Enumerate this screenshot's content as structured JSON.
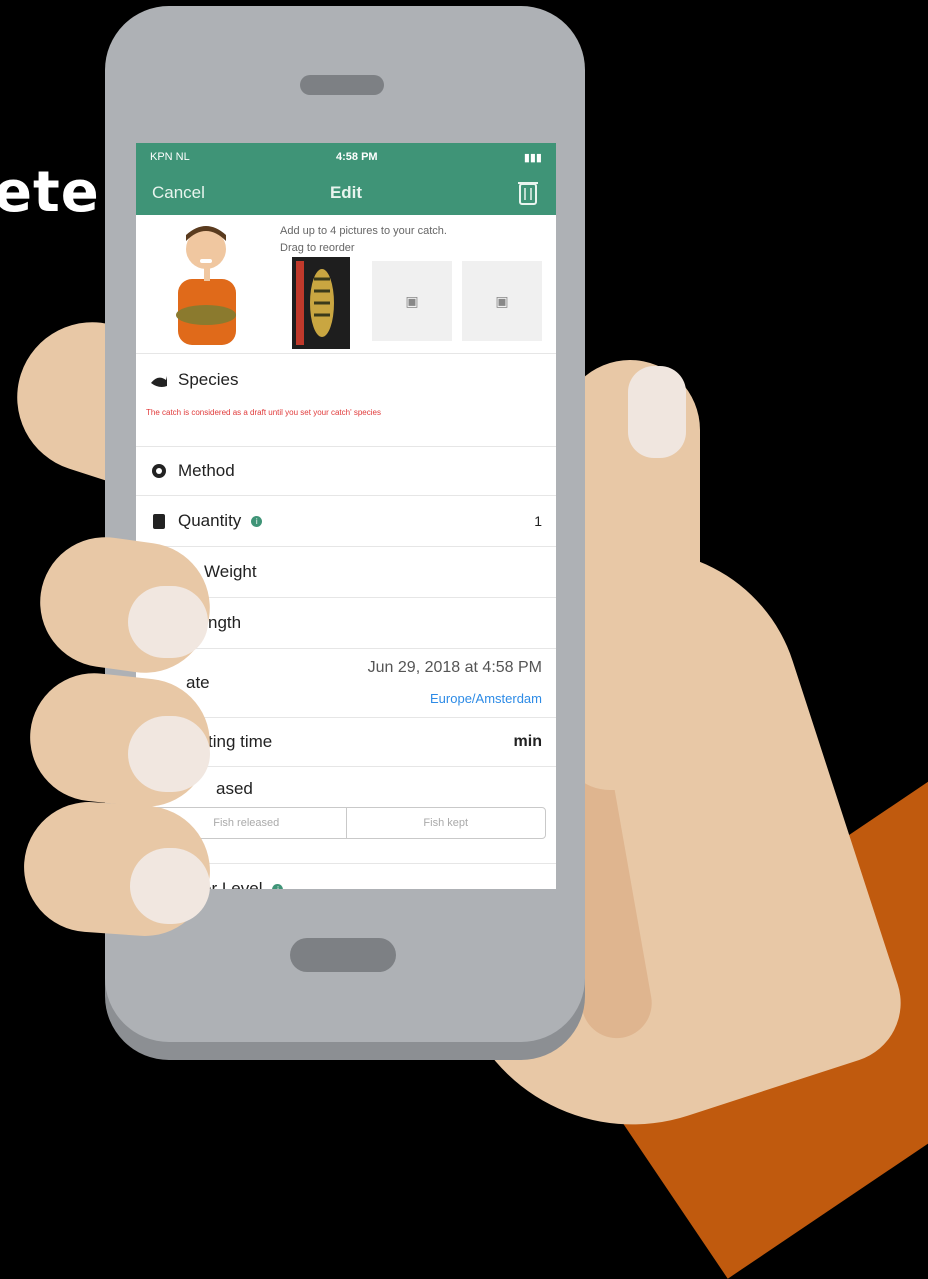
{
  "headline": "ete",
  "status_bar": {
    "carrier": "KPN NL",
    "time": "4:58 PM"
  },
  "nav": {
    "cancel_label": "Cancel",
    "title": "Edit"
  },
  "photos": {
    "hint_line1": "Add up to 4 pictures to your catch.",
    "hint_line2": "Drag to reorder"
  },
  "fields": {
    "species_label": "Species",
    "species_note": "The catch is considered as a draft until you set your catch' species",
    "method_label": "Method",
    "quantity_label": "Quantity",
    "quantity_value": "1",
    "weight_label": "Weight",
    "length_label": "ngth",
    "date_label": "ate",
    "date_value": "Jun 29, 2018 at 4:58 PM",
    "timezone_value": "Europe/Amsterdam",
    "fighting_label": "ting time",
    "fighting_value": "min",
    "released_label": "ased",
    "released_options": [
      "Fish released",
      "Fish kept"
    ],
    "water_label": "er Level"
  },
  "colors": {
    "brand_green": "#3f9477",
    "warning_red": "#e03a3a",
    "link_blue": "#2d8be6",
    "sleeve": "#c05a0e",
    "skin": "#e8c8a6"
  }
}
